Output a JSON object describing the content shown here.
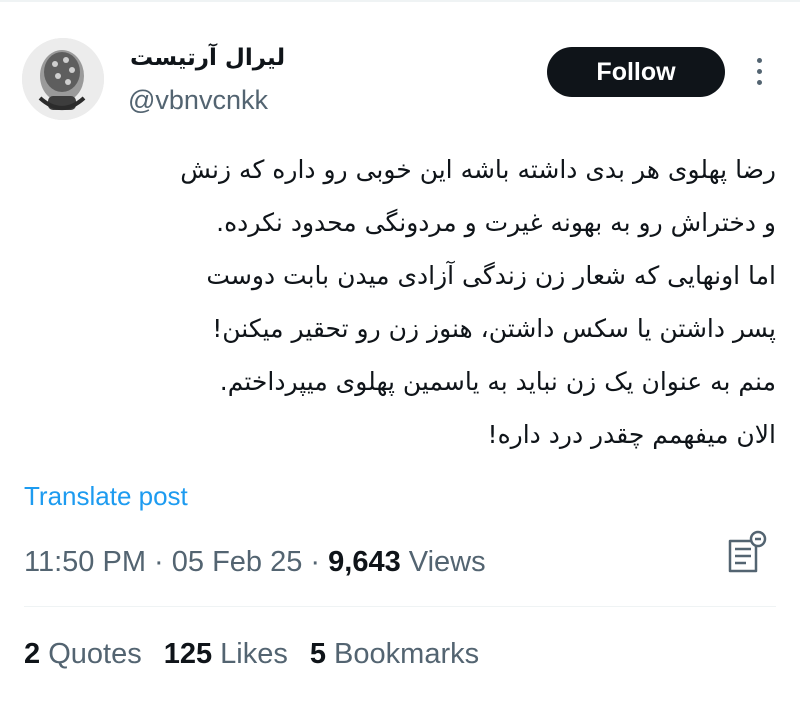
{
  "user": {
    "display_name": "لیرال آرتیست",
    "handle": "@vbnvcnkk",
    "avatar_icon": "avatar-photo"
  },
  "follow_label": "Follow",
  "more_icon": "more-vertical-icon",
  "tweet": {
    "lines": [
      "رضا پهلوی هر بدی داشته باشه این خوبی رو داره که زنش",
      "و دختراش رو به بهونه غیرت و مردونگی محدود نکرده.",
      "اما اونهایی که شعار زن زندگی آزادی میدن بابت دوست",
      "پسر داشتن یا سکس داشتن، هنوز زن رو تحقیر میکنن!",
      "منم به عنوان یک زن نباید به یاسمین پهلوی میپرداختم.",
      "الان میفهمم چقدر درد داره!"
    ]
  },
  "translate_label": "Translate post",
  "meta": {
    "time": "11:50 PM",
    "sep1": " · ",
    "date": "05 Feb 25",
    "sep2": " · ",
    "views_count": "9,643",
    "views_label": " Views"
  },
  "stats": {
    "quotes_count": "2",
    "quotes_label": " Quotes",
    "likes_count": "125",
    "likes_label": " Likes",
    "bookmarks_count": "5",
    "bookmarks_label": " Bookmarks"
  },
  "colors": {
    "text": "#0f1419",
    "secondary": "#536471",
    "link": "#1d9bf0",
    "button_bg": "#0f1419",
    "button_text": "#ffffff"
  }
}
